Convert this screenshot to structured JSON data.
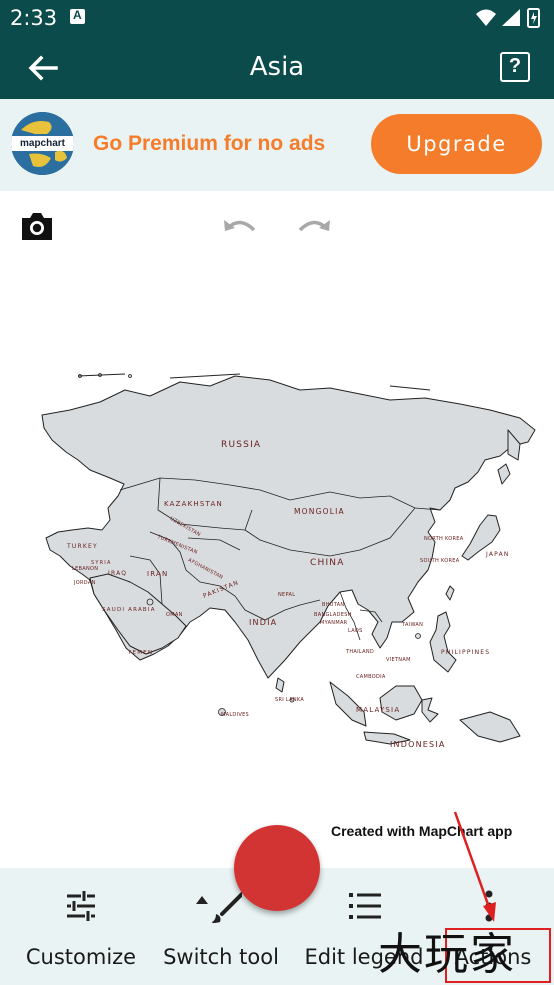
{
  "status_bar": {
    "time": "2:33",
    "left_icon_glyph": "A"
  },
  "app_bar": {
    "title": "Asia",
    "help_glyph": "?"
  },
  "ad": {
    "logo_text": "mapchart",
    "text": "Go Premium for no ads",
    "upgrade_label": "Upgrade"
  },
  "map": {
    "labels": {
      "russia": "RUSSIA",
      "kazakhstan": "KAZAKHSTAN",
      "mongolia": "MONGOLIA",
      "china": "CHINA",
      "turkey": "TURKEY",
      "iran": "IRAN",
      "iraq": "IRAQ",
      "syria": "SYRIA",
      "saudi_arabia": "SAUDI ARABIA",
      "yemen": "YEMEN",
      "afghanistan": "AFGHANISTAN",
      "pakistan": "PAKISTAN",
      "india": "INDIA",
      "turkmenistan": "TURKMENISTAN",
      "uzbekistan": "UZBEKISTAN",
      "japan": "JAPAN",
      "north_korea": "NORTH KOREA",
      "south_korea": "SOUTH KOREA",
      "philippines": "PHILIPPINES",
      "vietnam": "VIETNAM",
      "thailand": "THAILAND",
      "malaysia": "MALAYSIA",
      "indonesia": "INDONESIA",
      "sri_lanka": "SRI LANKA",
      "maldives": "MALDIVES",
      "myanmar": "MYANMAR",
      "laos": "LAOS",
      "cambodia": "CAMBODIA",
      "taiwan": "TAIWAN",
      "nepal": "NEPAL",
      "oman": "OMAN",
      "lebanon": "LEBANON",
      "jordan": "JORDAN",
      "bhutan": "BHUTAN",
      "bangladesh": "BANGLADESH"
    },
    "credit": "Created with MapChart app",
    "fill_color": "#d9dcde",
    "border_color": "#222222"
  },
  "bottom_nav": [
    {
      "id": "customize",
      "label": "Customize",
      "icon": "tune-icon"
    },
    {
      "id": "switch_tool",
      "label": "Switch tool",
      "icon": "brush-icon"
    },
    {
      "id": "edit_legend",
      "label": "Edit legend",
      "icon": "list-icon"
    },
    {
      "id": "actions",
      "label": "Actions",
      "icon": "more-vert-icon"
    }
  ],
  "watermark": "大玩家",
  "colors": {
    "primary": "#0b4b4b",
    "accent": "#f57c2a",
    "fab": "#d23434",
    "banner_bg": "#e9f3f3"
  }
}
